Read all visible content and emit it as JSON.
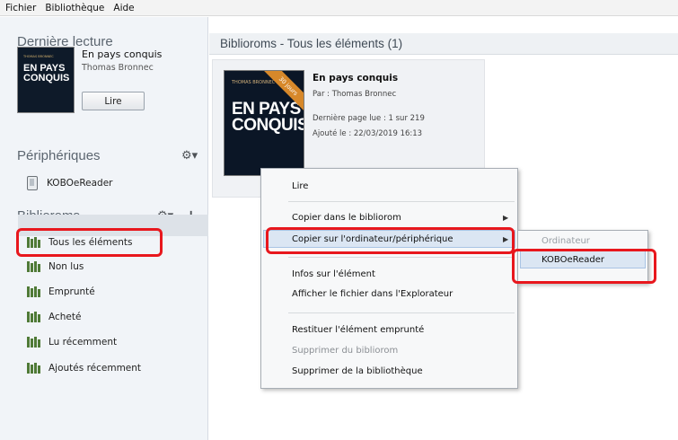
{
  "menubar": {
    "items": [
      "Fichier",
      "Bibliothèque",
      "Aide"
    ]
  },
  "sidebar": {
    "last_read": {
      "heading": "Dernière lecture",
      "title": "En pays conquis",
      "author": "Thomas Bronnec",
      "read_button": "Lire",
      "cover_lines": [
        "THOMAS BRONNEC",
        "EN PAYS CONQUIS"
      ]
    },
    "devices": {
      "heading": "Périphériques",
      "items": [
        {
          "label": "KOBOeReader",
          "icon": "ereader-icon"
        }
      ]
    },
    "biblioroms": {
      "heading": "Biblioroms",
      "items": [
        {
          "label": "Tous les éléments",
          "selected": true
        },
        {
          "label": "Non lus"
        },
        {
          "label": "Emprunté"
        },
        {
          "label": "Acheté"
        },
        {
          "label": "Lu récemment"
        },
        {
          "label": "Ajoutés récemment"
        }
      ]
    }
  },
  "main": {
    "title": "Biblioroms - Tous les éléments (1)",
    "book": {
      "title": "En pays conquis",
      "author": "Par : Thomas Bronnec",
      "last_page": "Dernière page lue : 1 sur 219",
      "added": "Ajouté le : 22/03/2019 16:13",
      "ribbon": "30 jours",
      "cover_author": "THOMAS BRONNEC",
      "cover_title": "EN PAYS CONQUIS"
    }
  },
  "context_menu": {
    "items": [
      {
        "label": "Lire"
      },
      {
        "label": "Copier dans le bibliorom",
        "submenu": true
      },
      {
        "label": "Copier sur l'ordinateur/périphérique",
        "submenu": true,
        "highlighted": true
      },
      {
        "label": "Infos sur l'élément"
      },
      {
        "label": "Afficher le fichier dans l'Explorateur"
      },
      {
        "label": "Restituer l'élément emprunté"
      },
      {
        "label": "Supprimer du bibliorom",
        "disabled": true
      },
      {
        "label": "Supprimer de la bibliothèque"
      }
    ],
    "submenu": {
      "items": [
        {
          "label": "Ordinateur",
          "disabled": true
        },
        {
          "label": "KOBOeReader",
          "highlighted": true
        }
      ]
    }
  },
  "colors": {
    "annotation": "#e8171d",
    "library_icon": "#4f7a36",
    "ribbon": "#d7882a"
  }
}
